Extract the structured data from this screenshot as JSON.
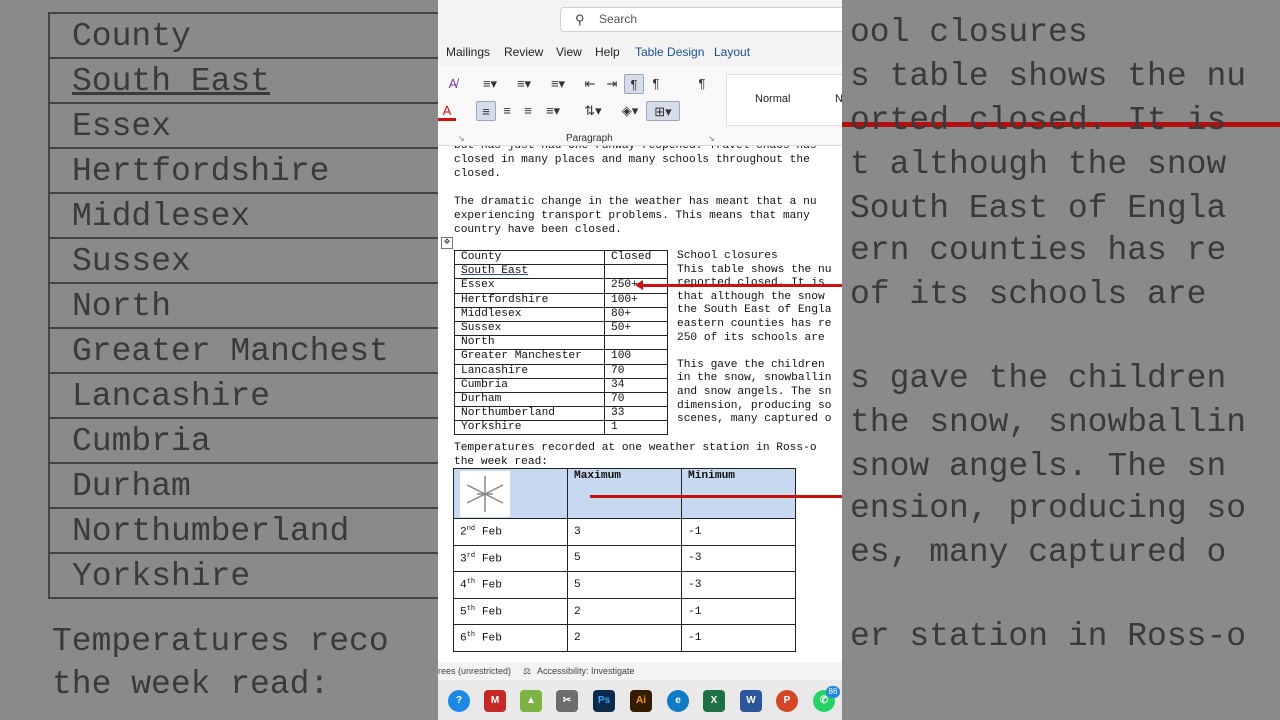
{
  "background_left": {
    "rows": [
      "County",
      "South East",
      "Essex",
      "Hertfordshire",
      "Middlesex",
      "Sussex",
      "North",
      "Greater Manchest",
      "Lancashire",
      "Cumbria",
      "Durham",
      "Northumberland",
      "Yorkshire"
    ],
    "footer": [
      "Temperatures reco",
      "the week read:"
    ]
  },
  "background_right": {
    "lines": [
      "ool closures",
      "s table shows the nu",
      "orted closed. It is",
      "t although the snow",
      "South East of Engla",
      "ern counties has re",
      "of its schools are",
      "s gave the children",
      "the snow, snowballin",
      "snow angels. The sn",
      "ension, producing so",
      "es, many captured o",
      "er station in Ross-o"
    ]
  },
  "search": {
    "placeholder": "Search"
  },
  "tabs": [
    "Mailings",
    "Review",
    "View",
    "Help",
    "Table Design",
    "Layout"
  ],
  "ribbon": {
    "group_label": "Paragraph",
    "styles": [
      "Normal",
      "N"
    ]
  },
  "document": {
    "intro_lines": [
      "but has just had one runway reopened. Travel chaos has",
      "closed in many places and many schools throughout the",
      "closed."
    ],
    "para2_lines": [
      "The dramatic change in the weather has meant that a nu",
      "experiencing transport problems. This means that many",
      "country have been closed."
    ],
    "closures_table": {
      "headers": [
        "County",
        "Closed"
      ],
      "rows": [
        [
          "South East",
          ""
        ],
        [
          "Essex",
          "250+"
        ],
        [
          "Hertfordshire",
          "100+"
        ],
        [
          "Middlesex",
          "80+"
        ],
        [
          "Sussex",
          "50+"
        ],
        [
          "North",
          ""
        ],
        [
          "Greater Manchester",
          "100"
        ],
        [
          "Lancashire",
          "70"
        ],
        [
          "Cumbria",
          "34"
        ],
        [
          "Durham",
          "70"
        ],
        [
          "Northumberland",
          "33"
        ],
        [
          "Yorkshire",
          "1"
        ]
      ]
    },
    "side_text": {
      "heading": "School closures",
      "lines1": [
        "This table shows the nu",
        "reported closed. It is",
        "that although the snow",
        "the South East of Engla",
        "eastern counties has re",
        "250 of its schools are"
      ],
      "lines2": [
        "This gave the children",
        "in the snow, snowballin",
        "and snow angels. The sn",
        "dimension, producing so",
        "scenes, many captured o"
      ]
    },
    "temps_caption": [
      "Temperatures recorded at one weather station in Ross-o",
      "the week read:"
    ],
    "temps_table": {
      "headers": [
        "",
        "Maximum",
        "Minimum"
      ],
      "rows": [
        [
          "2nd Feb",
          "3",
          "-1"
        ],
        [
          "3rd Feb",
          "5",
          "-3"
        ],
        [
          "4th Feb",
          "5",
          "-3"
        ],
        [
          "5th Feb",
          "2",
          "-1"
        ],
        [
          "6th Feb",
          "2",
          "-1"
        ]
      ]
    }
  },
  "status": {
    "left": "rees (unrestricted)",
    "accessibility": "Accessibility: Investigate"
  },
  "taskbar": {
    "badge": "86",
    "apps": [
      "help-app",
      "mcafee-app",
      "image-app",
      "snip-app",
      "photoshop-app",
      "illustrator-app",
      "edge-app",
      "excel-app",
      "word-app",
      "powerpoint-app",
      "whatsapp-app"
    ]
  },
  "colors": {
    "accent": "#cc1111",
    "table_header": "#c6d9f1",
    "tab_blue": "#1a4f9c"
  }
}
